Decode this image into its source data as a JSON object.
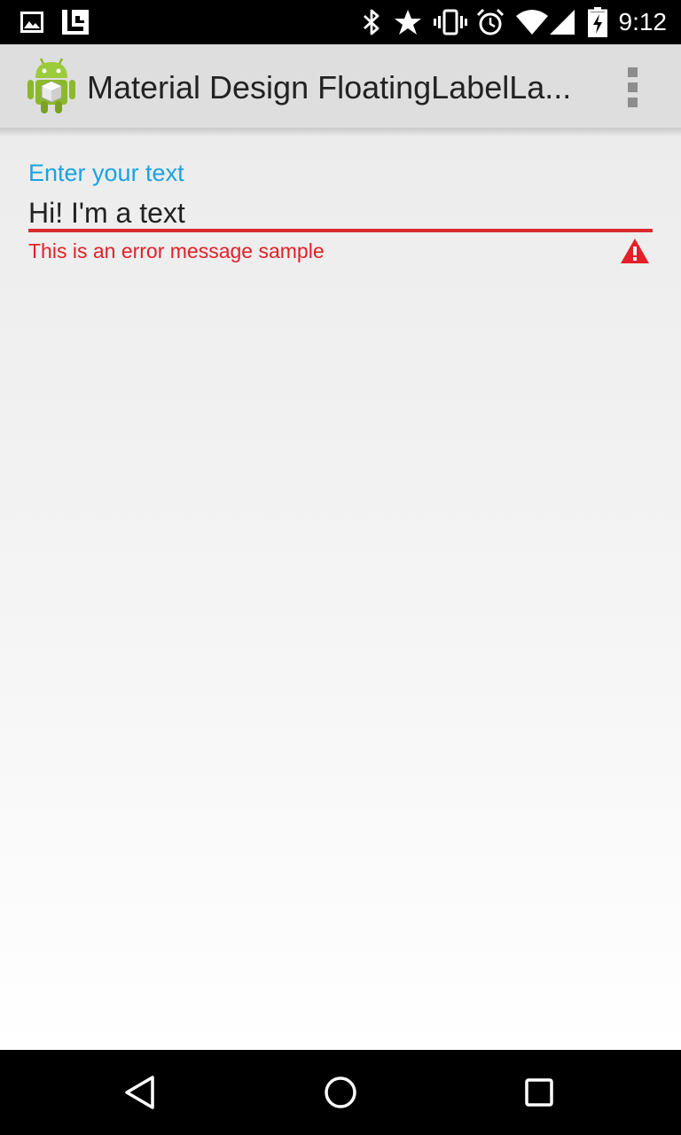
{
  "status_bar": {
    "time": "9:12",
    "left_icons": [
      "gallery-notification-icon",
      "app-notification-icon"
    ],
    "right_icons": [
      "bluetooth-icon",
      "star-icon",
      "vibrate-icon",
      "alarm-icon",
      "wifi-icon",
      "cell-signal-icon",
      "battery-charging-icon"
    ]
  },
  "action_bar": {
    "title": "Material Design FloatingLabelLa...",
    "app_icon": "android-app-icon",
    "overflow_icon": "overflow-menu-icon"
  },
  "form": {
    "floating_label": "Enter your text",
    "input_value": "Hi! I'm a text",
    "error_message": "This is an error message sample",
    "error_icon": "warning-icon",
    "colors": {
      "label": "#1ba2e3",
      "error": "#e32027",
      "underline": "#d92b2f"
    }
  },
  "nav_bar": {
    "buttons": [
      "back-icon",
      "home-icon",
      "recents-icon"
    ]
  }
}
